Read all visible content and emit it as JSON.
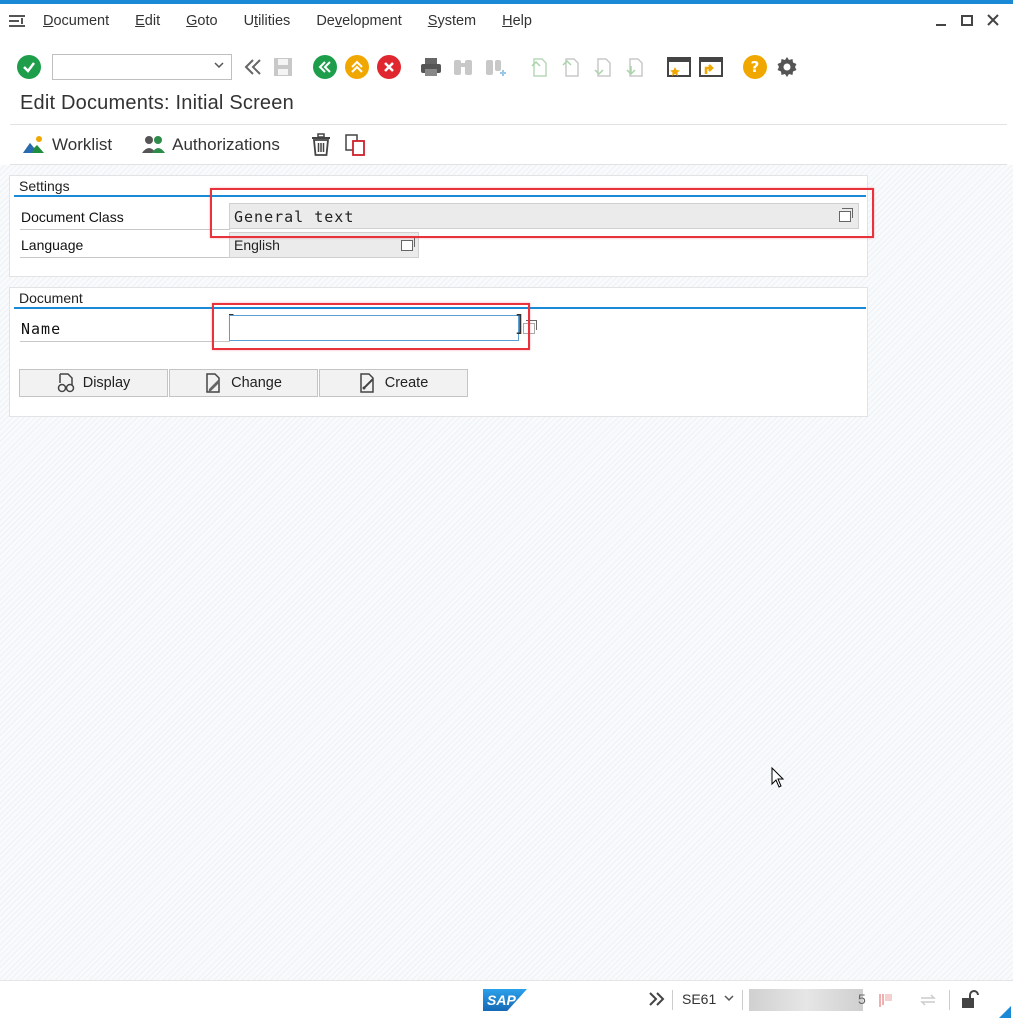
{
  "menu": {
    "items": [
      {
        "label": "Document",
        "ul": "D",
        "rest": "ocument"
      },
      {
        "label": "Edit",
        "ul": "E",
        "rest": "dit"
      },
      {
        "label": "Goto",
        "ul": "G",
        "rest": "oto"
      },
      {
        "label": "Utilities",
        "pre": "U",
        "ul": "t",
        "rest": "ilities"
      },
      {
        "label": "Development",
        "pre": "De",
        "ul": "v",
        "rest": "elopment"
      },
      {
        "label": "System",
        "ul": "S",
        "rest": "ystem"
      },
      {
        "label": "Help",
        "ul": "H",
        "rest": "elp"
      }
    ]
  },
  "page": {
    "title": "Edit Documents: Initial Screen"
  },
  "apptoolbar": {
    "worklist_label": "Worklist",
    "authorizations_label": "Authorizations"
  },
  "settings": {
    "title": "Settings",
    "document_class_label": "Document Class",
    "document_class_value": "General text",
    "language_label": "Language",
    "language_value": "English"
  },
  "document": {
    "title": "Document",
    "name_label": "Name",
    "name_value": "",
    "display_label": "Display",
    "change_label": "Change",
    "create_label": "Create"
  },
  "status": {
    "logo": "SAP",
    "transaction": "SE61",
    "partial_text": "5"
  },
  "colors": {
    "accent": "#1a8ad6",
    "highlight": "#e8323c",
    "ok_green": "#1e9e4a",
    "cancel_red": "#e0262e",
    "nav_orange": "#f0a800"
  }
}
